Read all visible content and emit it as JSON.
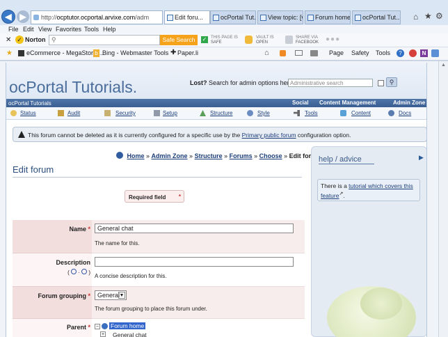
{
  "browser": {
    "address_prefix": "http://",
    "address_domain": "ocptutor.ocportal.arvixe.com",
    "address_path": "/adm",
    "tabs": [
      {
        "label": "Edit foru..."
      },
      {
        "label": "ocPortal Tut..."
      },
      {
        "label": "View topic: [v..."
      },
      {
        "label": "Forum home..."
      },
      {
        "label": "ocPortal Tut..."
      }
    ],
    "menu": [
      "File",
      "Edit",
      "View",
      "Favorites",
      "Tools",
      "Help"
    ],
    "norton": {
      "brand": "Norton",
      "safe_search": "Safe Search",
      "page_is_safe_1": "THIS PAGE IS",
      "page_is_safe_2": "SAFE",
      "vault_1": "VAULT IS",
      "vault_2": "OPEN",
      "share_1": "SHARE VIA",
      "share_2": "FACEBOOK"
    },
    "favorites": [
      "eCommerce - MegaStore ...",
      "Bing - Webmaster Tools",
      "Paper.li"
    ],
    "commands": [
      "Page",
      "Safety",
      "Tools"
    ]
  },
  "site": {
    "title": "ocPortal Tutorials.",
    "lost_label": "Lost?",
    "search_hint": "Search for admin options here",
    "search_placeholder": "Administrative search",
    "bar_title": "ocPortal Tutorials",
    "bar_links": [
      "Social",
      "Content Management",
      "Admin Zone"
    ],
    "zones": [
      "Status",
      "Audit",
      "Security",
      "Setup",
      "Structure",
      "Style",
      "Tools",
      "Content",
      "Docs"
    ]
  },
  "notice": {
    "text_before": "This forum cannot be deleted as it is currently configured for a specific use by the",
    "link": "Primary public forum",
    "text_after": "configuration option."
  },
  "breadcrumb": [
    "Home",
    "Admin Zone",
    "Structure",
    "Forums",
    "Choose"
  ],
  "breadcrumb_current": "Edit forum",
  "page_title": "Edit forum",
  "required_field": "Required field",
  "form": {
    "name": {
      "label": "Name",
      "value": "General chat",
      "desc": "The name for this."
    },
    "description": {
      "label": "Description",
      "value": "",
      "desc": "A concise description for this."
    },
    "grouping": {
      "label": "Forum grouping",
      "value": "General",
      "desc": "The forum grouping to place this forum under."
    },
    "parent": {
      "label": "Parent",
      "tree_root": "Forum home",
      "tree_child": "General chat"
    }
  },
  "help": {
    "title": "help / advice",
    "text_before": "There is a",
    "link": "tutorial which covers this feature",
    "text_after": "."
  },
  "colors": {
    "accent": "#3a5e92",
    "brand_title": "#4a6d9c",
    "link": "#1a3d7a",
    "required_bg": "#f3dede"
  }
}
